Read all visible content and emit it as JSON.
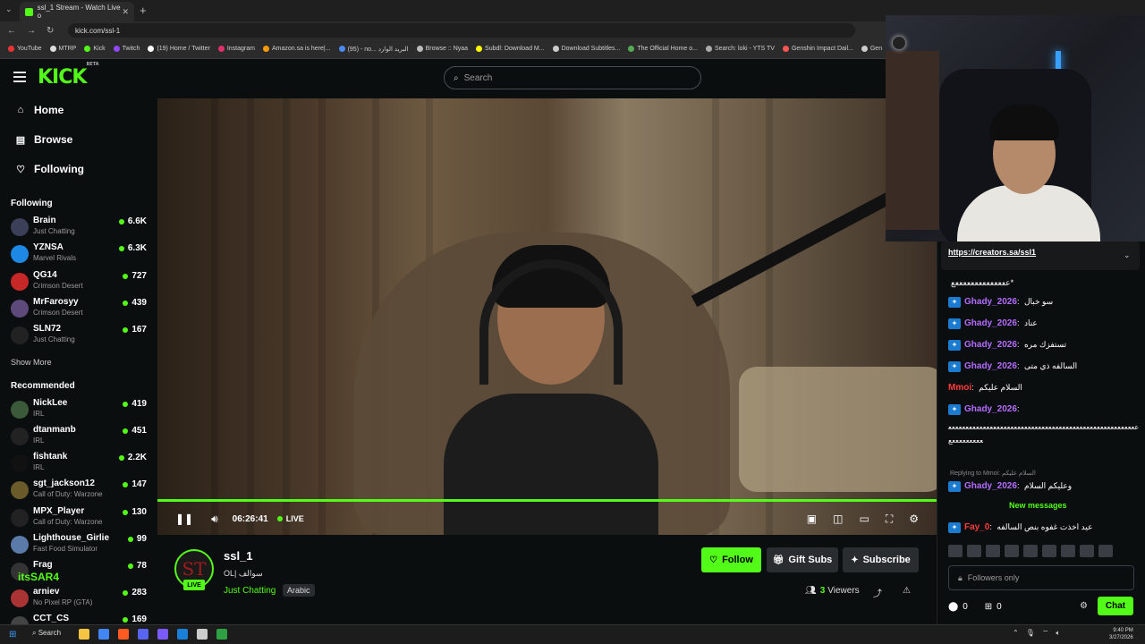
{
  "browser": {
    "tab_title": "ssl_1 Stream - Watch Live o",
    "url": "kick.com/ssl-1",
    "bookmarks": [
      "YouTube",
      "MTRP",
      "Kick",
      "Twitch",
      "(19) Home / Twitter",
      "Instagram",
      "Amazon.sa is here|...",
      "(95) - no... البريد الوارد",
      "Browse :: Nyaa",
      "Subdl: Download M...",
      "Download Subtitles...",
      "The Official Home o...",
      "Search: loki - YTS TV",
      "Genshin Impact Dail...",
      "Gen"
    ]
  },
  "header": {
    "logo": "KICK",
    "logo_beta": "BETA",
    "search_placeholder": "Search"
  },
  "sidebar": {
    "nav": [
      {
        "label": "Home",
        "icon": "home-icon"
      },
      {
        "label": "Browse",
        "icon": "browse-icon"
      },
      {
        "label": "Following",
        "icon": "heart-icon"
      }
    ],
    "following_title": "Following",
    "following": [
      {
        "name": "Brain",
        "category": "Just Chatting",
        "viewers": "6.6K"
      },
      {
        "name": "YZNSA",
        "category": "Marvel Rivals",
        "viewers": "6.3K"
      },
      {
        "name": "QG14",
        "category": "Crimson Desert",
        "viewers": "727"
      },
      {
        "name": "MrFarosyy",
        "category": "Crimson Desert",
        "viewers": "439"
      },
      {
        "name": "SLN72",
        "category": "Just Chatting",
        "viewers": "167"
      }
    ],
    "show_more": "Show More",
    "recommended_title": "Recommended",
    "recommended": [
      {
        "name": "NickLee",
        "category": "IRL",
        "viewers": "419"
      },
      {
        "name": "dtanmanb",
        "category": "IRL",
        "viewers": "451"
      },
      {
        "name": "fishtank",
        "category": "IRL",
        "viewers": "2.2K"
      },
      {
        "name": "sgt_jackson12",
        "category": "Call of Duty: Warzone",
        "viewers": "147"
      },
      {
        "name": "MPX_Player",
        "category": "Call of Duty: Warzone",
        "viewers": "130"
      },
      {
        "name": "Lighthouse_Girlie",
        "category": "Fast Food Simulator",
        "viewers": "99"
      },
      {
        "name": "Frag",
        "category": "",
        "viewers": "78"
      },
      {
        "name": "arniev",
        "category": "No Pixel RP (GTA)",
        "viewers": "283"
      },
      {
        "name": "CCT_CS",
        "category": "",
        "viewers": "169"
      }
    ]
  },
  "player": {
    "time": "06:26:41",
    "live_label": "LIVE",
    "progress": 1.0
  },
  "channel": {
    "name": "ssl_1",
    "title": "OL| سوالف",
    "category": "Just Chatting",
    "language": "Arabic",
    "avatar_letters": "ST",
    "live_badge": "LIVE",
    "viewers_count": "3",
    "viewers_label": "Viewers",
    "follow_label": "Follow",
    "gift_label": "Gift Subs",
    "subscribe_label": "Subscribe"
  },
  "overlay_name": "itsSAR4",
  "chat": {
    "pinned_link": "https://creators.sa/ssl1",
    "messages": [
      {
        "user": "",
        "text": "ععععععععععععععع*"
      },
      {
        "user": "Ghady_2026",
        "text": "سو خبال"
      },
      {
        "user": "Ghady_2026",
        "text": "عناد"
      },
      {
        "user": "Ghady_2026",
        "text": "تستفزك مره"
      },
      {
        "user": "Ghady_2026",
        "text": "السالفه ذي متى"
      },
      {
        "user": "Mmoi",
        "text": "السلام عليكم"
      },
      {
        "user": "Ghady_2026",
        "text": ""
      }
    ],
    "long_message": "ععععععععععععععععععععععععععععععععععععععععععععععععععععععععععععععععع",
    "reply_hint": "Replying to Mmoi: السلام عليكم",
    "reply_message": {
      "user": "Ghady_2026",
      "text": "وعليكم السلام"
    },
    "new_messages": "New messages",
    "last_message": {
      "user": "Fay_0",
      "text": "عيد اخذت غفوه بنص السالفه"
    },
    "input_placeholder": "Followers only",
    "gift_count": "0",
    "drops_count": "0",
    "chat_button": "Chat",
    "colors": {
      "ghady": "#b46cff",
      "mmoi": "#ff3b3b",
      "fay": "#ff3b3b",
      "accent": "#53fc18"
    }
  },
  "taskbar": {
    "search": "Search",
    "time": "9:40 PM",
    "date": "3/27/2026"
  }
}
